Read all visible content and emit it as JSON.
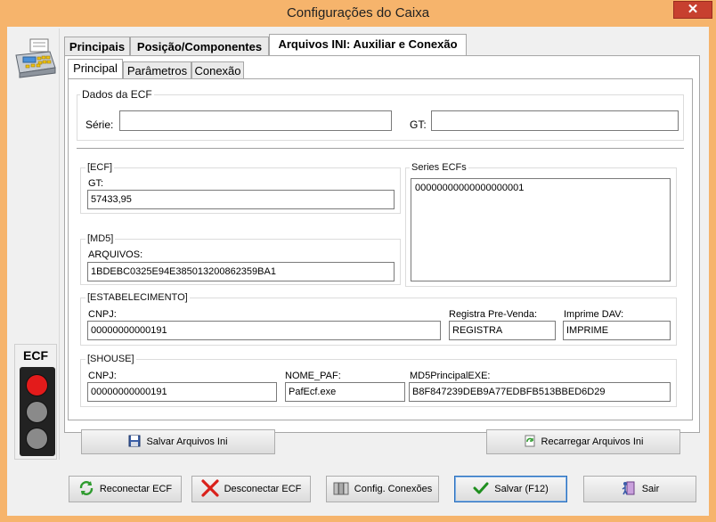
{
  "window": {
    "title": "Configurações do Caixa",
    "close_glyph": "✕"
  },
  "tabs": [
    {
      "label": "Principais"
    },
    {
      "label": "Posição/Componentes"
    },
    {
      "label": "Arquivos INI: Auxiliar e Conexão"
    }
  ],
  "subtabs": [
    {
      "label": "Principal"
    },
    {
      "label": "Parâmetros"
    },
    {
      "label": "Conexão"
    }
  ],
  "dados_ecf": {
    "legend": "Dados da ECF",
    "serie_label": "Série:",
    "serie_value": "",
    "gt_label": "GT:",
    "gt_value": ""
  },
  "ecf": {
    "legend": "[ECF]",
    "gt_label": "GT:",
    "gt_value": "57433,95"
  },
  "md5": {
    "legend": "[MD5]",
    "arquivos_label": "ARQUIVOS:",
    "arquivos_value": "1BDEBC0325E94E385013200862359BA1"
  },
  "series_ecfs": {
    "legend": "Series ECFs",
    "items": [
      "00000000000000000001"
    ]
  },
  "estabelecimento": {
    "legend": "[ESTABELECIMENTO]",
    "cnpj_label": "CNPJ:",
    "cnpj_value": "00000000000191",
    "registra_label": "Registra Pre-Venda:",
    "registra_value": "REGISTRA",
    "imprime_label": "Imprime DAV:",
    "imprime_value": "IMPRIME"
  },
  "shouse": {
    "legend": "[SHOUSE]",
    "cnpj_label": "CNPJ:",
    "cnpj_value": "00000000000191",
    "nome_label": "NOME_PAF:",
    "nome_value": "PafEcf.exe",
    "md5_label": "MD5PrincipalEXE:",
    "md5_value": "B8F847239DEB9A77EDBFB513BBED6D29"
  },
  "ini_buttons": {
    "salvar": "Salvar Arquivos Ini",
    "recarregar": "Recarregar Arquivos Ini"
  },
  "ecf_status": {
    "label": "ECF",
    "colors": {
      "red": "#e31b1b",
      "off": "#8a8a8a"
    }
  },
  "bottom_buttons": {
    "reconectar": "Reconectar ECF",
    "desconectar": "Desconectar ECF",
    "config": "Config. Conexões",
    "salvar": "Salvar (F12)",
    "sair": "Sair"
  },
  "colors": {
    "titlebar": "#f6b46c",
    "close": "#c7402f"
  }
}
